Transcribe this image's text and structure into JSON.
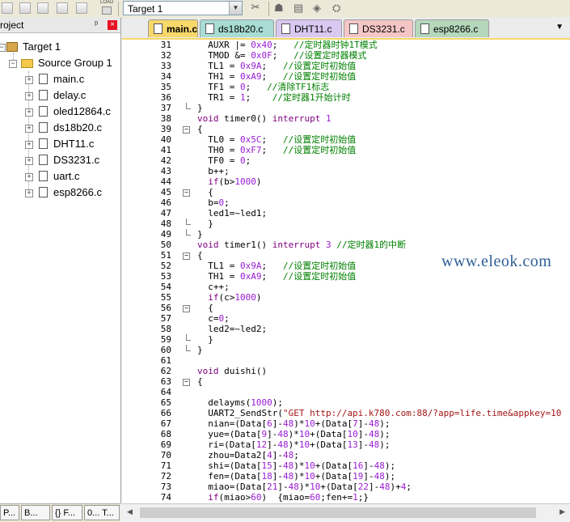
{
  "toolbar": {
    "target_select": "Target 1",
    "load_label": "LOAD"
  },
  "project_panel": {
    "title": "roject",
    "pin": "ᵖ",
    "close": "×",
    "tree": {
      "target": "Target 1",
      "group": "Source Group 1",
      "files": [
        "main.c",
        "delay.c",
        "oled12864.c",
        "ds18b20.c",
        "DHT11.c",
        "DS3231.c",
        "uart.c",
        "esp8266.c"
      ]
    },
    "bottom_tabs": [
      "P...",
      "B...",
      "{} F...",
      "0... T..."
    ]
  },
  "editor": {
    "tabs": [
      {
        "label": "main.c",
        "color": "#f7d86b",
        "active": true
      },
      {
        "label": "ds18b20.c",
        "color": "#a8dcd4"
      },
      {
        "label": "DHT11.c",
        "color": "#d9c8f0"
      },
      {
        "label": "DS3231.c",
        "color": "#f5c6c6"
      },
      {
        "label": "esp8266.c",
        "color": "#b5d7bc"
      }
    ],
    "tab_menu": "▼",
    "lines": [
      {
        "n": "31",
        "html": "  AUXR |= <span class=\"n\">0x40</span>;   <span class=\"c\">//定时器时钟1T模式</span>",
        "fold": ""
      },
      {
        "n": "32",
        "html": "  TMOD &amp;= <span class=\"n\">0x0F</span>;   <span class=\"c\">//设置定时器模式</span>",
        "fold": ""
      },
      {
        "n": "33",
        "html": "  TL1 = <span class=\"n\">0x9A</span>;   <span class=\"c\">//设置定时初始值</span>",
        "fold": ""
      },
      {
        "n": "34",
        "html": "  TH1 = <span class=\"n\">0xA9</span>;   <span class=\"c\">//设置定时初始值</span>",
        "fold": ""
      },
      {
        "n": "35",
        "html": "  TF1 = <span class=\"n\">0</span>;   <span class=\"c\">//清除TF1标志</span>",
        "fold": ""
      },
      {
        "n": "36",
        "html": "  TR1 = <span class=\"n\">1</span>;    <span class=\"c\">//定时器1开始计时</span>",
        "fold": ""
      },
      {
        "n": "37",
        "html": "}",
        "fold": "end"
      },
      {
        "n": "38",
        "html": "<span class=\"k\">void</span> timer0() <span class=\"k\">interrupt</span> <span class=\"n\">1</span>",
        "fold": ""
      },
      {
        "n": "39",
        "html": "{",
        "fold": "open"
      },
      {
        "n": "40",
        "html": "  TL0 = <span class=\"n\">0x5C</span>;   <span class=\"c\">//设置定时初始值</span>",
        "fold": ""
      },
      {
        "n": "41",
        "html": "  TH0 = <span class=\"n\">0xF7</span>;   <span class=\"c\">//设置定时初始值</span>",
        "fold": ""
      },
      {
        "n": "42",
        "html": "  TF0 = <span class=\"n\">0</span>;",
        "fold": ""
      },
      {
        "n": "43",
        "html": "  b++;",
        "fold": ""
      },
      {
        "n": "44",
        "html": "  <span class=\"k\">if</span>(b&gt;<span class=\"n\">1000</span>)",
        "fold": ""
      },
      {
        "n": "45",
        "html": "  {",
        "fold": "open"
      },
      {
        "n": "46",
        "html": "  b=<span class=\"n\">0</span>;",
        "fold": ""
      },
      {
        "n": "47",
        "html": "  led1=~led1;",
        "fold": ""
      },
      {
        "n": "48",
        "html": "  }",
        "fold": "end"
      },
      {
        "n": "49",
        "html": "}",
        "fold": "end"
      },
      {
        "n": "50",
        "html": "<span class=\"k\">void</span> timer1() <span class=\"k\">interrupt</span> <span class=\"n\">3</span> <span class=\"c\">//定时器1的中断</span>",
        "fold": ""
      },
      {
        "n": "51",
        "html": "{",
        "fold": "open"
      },
      {
        "n": "52",
        "html": "  TL1 = <span class=\"n\">0x9A</span>;   <span class=\"c\">//设置定时初始值</span>",
        "fold": ""
      },
      {
        "n": "53",
        "html": "  TH1 = <span class=\"n\">0xA9</span>;   <span class=\"c\">//设置定时初始值</span>",
        "fold": ""
      },
      {
        "n": "54",
        "html": "  c++;",
        "fold": ""
      },
      {
        "n": "55",
        "html": "  <span class=\"k\">if</span>(c&gt;<span class=\"n\">1000</span>)",
        "fold": ""
      },
      {
        "n": "56",
        "html": "  {",
        "fold": "open"
      },
      {
        "n": "57",
        "html": "  c=<span class=\"n\">0</span>;",
        "fold": ""
      },
      {
        "n": "58",
        "html": "  led2=~led2;",
        "fold": ""
      },
      {
        "n": "59",
        "html": "  }",
        "fold": "end"
      },
      {
        "n": "60",
        "html": "}",
        "fold": "end"
      },
      {
        "n": "61",
        "html": "",
        "fold": ""
      },
      {
        "n": "62",
        "html": "<span class=\"k\">void</span> duishi()",
        "fold": ""
      },
      {
        "n": "63",
        "html": "{",
        "fold": "open"
      },
      {
        "n": "64",
        "html": "",
        "fold": ""
      },
      {
        "n": "65",
        "html": "  delayms(<span class=\"n\">1000</span>);",
        "fold": ""
      },
      {
        "n": "66",
        "html": "  UART2_SendStr(<span class=\"s\">\"GET http://api.k780.com:88/?app=life.time&amp;appkey=10</span>",
        "fold": ""
      },
      {
        "n": "67",
        "html": "  nian=(Data[<span class=\"n\">6</span>]-<span class=\"n\">48</span>)*<span class=\"n\">10</span>+(Data[<span class=\"n\">7</span>]-<span class=\"n\">48</span>);",
        "fold": ""
      },
      {
        "n": "68",
        "html": "  yue=(Data[<span class=\"n\">9</span>]-<span class=\"n\">48</span>)*<span class=\"n\">10</span>+(Data[<span class=\"n\">10</span>]-<span class=\"n\">48</span>);",
        "fold": ""
      },
      {
        "n": "69",
        "html": "  ri=(Data[<span class=\"n\">12</span>]-<span class=\"n\">48</span>)*<span class=\"n\">10</span>+(Data[<span class=\"n\">13</span>]-<span class=\"n\">48</span>);",
        "fold": ""
      },
      {
        "n": "70",
        "html": "  zhou=Data2[<span class=\"n\">4</span>]-<span class=\"n\">48</span>;",
        "fold": ""
      },
      {
        "n": "71",
        "html": "  shi=(Data[<span class=\"n\">15</span>]-<span class=\"n\">48</span>)*<span class=\"n\">10</span>+(Data[<span class=\"n\">16</span>]-<span class=\"n\">48</span>);",
        "fold": ""
      },
      {
        "n": "72",
        "html": "  fen=(Data[<span class=\"n\">18</span>]-<span class=\"n\">48</span>)*<span class=\"n\">10</span>+(Data[<span class=\"n\">19</span>]-<span class=\"n\">48</span>);",
        "fold": ""
      },
      {
        "n": "73",
        "html": "  miao=(Data[<span class=\"n\">21</span>]-<span class=\"n\">48</span>)*<span class=\"n\">10</span>+(Data[<span class=\"n\">22</span>]-<span class=\"n\">48</span>)+<span class=\"n\">4</span>;",
        "fold": ""
      },
      {
        "n": "74",
        "html": "  <span class=\"k\">if</span>(miao&gt;<span class=\"n\">60</span>)  {miao=<span class=\"n\">60</span>;fen+=<span class=\"n\">1</span>;}",
        "fold": ""
      }
    ]
  },
  "watermark": "www.eleok.com"
}
